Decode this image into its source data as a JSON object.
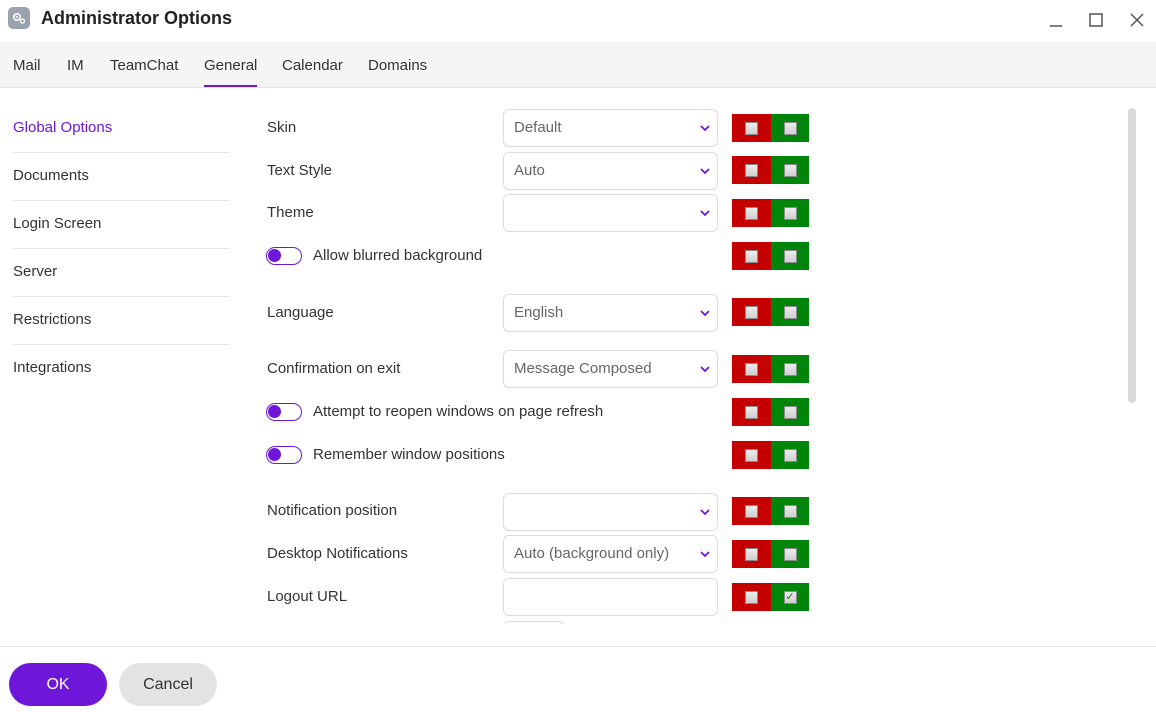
{
  "window": {
    "title": "Administrator Options",
    "icon": "gear-icon"
  },
  "tabs": [
    {
      "label": "Mail"
    },
    {
      "label": "IM"
    },
    {
      "label": "TeamChat"
    },
    {
      "label": "General",
      "active": true
    },
    {
      "label": "Calendar"
    },
    {
      "label": "Domains"
    }
  ],
  "sidebar": {
    "items": [
      {
        "label": "Global Options",
        "active": true
      },
      {
        "label": "Documents"
      },
      {
        "label": "Login Screen"
      },
      {
        "label": "Server"
      },
      {
        "label": "Restrictions"
      },
      {
        "label": "Integrations"
      }
    ]
  },
  "settings": {
    "skin": {
      "label": "Skin",
      "value": "Default",
      "deny": false,
      "allow": false
    },
    "text_style": {
      "label": "Text Style",
      "value": "Auto",
      "deny": false,
      "allow": false
    },
    "theme": {
      "label": "Theme",
      "value": "",
      "deny": false,
      "allow": false
    },
    "blurred_background": {
      "label": "Allow blurred background",
      "on": false,
      "deny": false,
      "allow": false
    },
    "language": {
      "label": "Language",
      "value": "English",
      "deny": false,
      "allow": false
    },
    "confirmation_on_exit": {
      "label": "Confirmation on exit",
      "value": "Message Composed",
      "deny": false,
      "allow": false
    },
    "reopen_windows": {
      "label": "Attempt to reopen windows on page refresh",
      "on": false,
      "deny": false,
      "allow": false
    },
    "remember_positions": {
      "label": "Remember window positions",
      "on": false,
      "deny": false,
      "allow": false
    },
    "notification_position": {
      "label": "Notification position",
      "value": "",
      "deny": false,
      "allow": false
    },
    "desktop_notifications": {
      "label": "Desktop Notifications",
      "value": "Auto (background only)",
      "deny": false,
      "allow": false
    },
    "logout_url": {
      "label": "Logout URL",
      "value": "",
      "deny": false,
      "allow": true
    }
  },
  "footer": {
    "ok_label": "OK",
    "cancel_label": "Cancel"
  },
  "colors": {
    "accent": "#6f17d9",
    "deny": "#c40000",
    "allow": "#00850a"
  }
}
